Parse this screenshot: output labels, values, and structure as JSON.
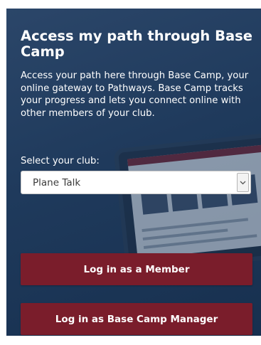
{
  "section": {
    "title": "Access my path through Base Camp",
    "description": "Access your path here through Base Camp, your online gateway to Pathways. Base Camp tracks your progress and lets you connect online with other members of your club."
  },
  "club_select": {
    "label": "Select your club:",
    "value": "Plane Talk",
    "icon": "chevron-down-icon"
  },
  "buttons": {
    "member_login": "Log in as a Member",
    "manager_login": "Log in as Base Camp Manager"
  },
  "colors": {
    "panel_bg": "#1f3a5c",
    "button_bg": "#7a1d2b",
    "text": "#ffffff"
  }
}
